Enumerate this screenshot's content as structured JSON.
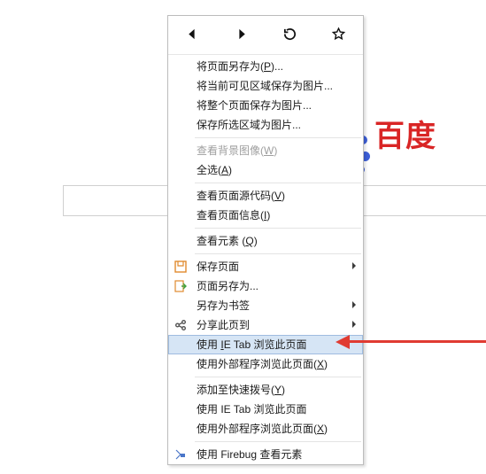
{
  "page": {
    "baidu_text": "百度"
  },
  "menu": {
    "save_page_as": "将页面另存为(",
    "save_page_as_key": "P",
    "save_page_as_tail": ")...",
    "save_visible_area_as_image": "将当前可见区域保存为图片...",
    "save_whole_page_as_image": "将整个页面保存为图片...",
    "save_selection_as_image": "保存所选区域为图片...",
    "view_bg_image": "查看背景图像(",
    "view_bg_image_key": "W",
    "view_bg_image_tail": ")",
    "select_all": "全选(",
    "select_all_key": "A",
    "select_all_tail": ")",
    "view_source": "查看页面源代码(",
    "view_source_key": "V",
    "view_source_tail": ")",
    "view_page_info": "查看页面信息(",
    "view_page_info_key": "I",
    "view_page_info_tail": ")",
    "inspect_element": "查看元素 (",
    "inspect_element_key": "Q",
    "inspect_element_tail": ")",
    "save_page": "保存页面",
    "page_save_as": "页面另存为...",
    "save_as_bookmark": "另存为书签",
    "share_page_to": "分享此页到",
    "use_ie_tab_prefix": "使用 ",
    "use_ie_tab_ie": "I",
    "use_ie_tab_mid": "E Tab 浏览此页面",
    "use_external_browse": "使用外部程序浏览此页面(",
    "use_external_browse_key": "X",
    "use_external_browse_tail": ")",
    "add_to_speed_dial": "添加至快速拨号(",
    "add_to_speed_dial_key": "Y",
    "add_to_speed_dial_tail": ")",
    "use_ie_tab2": "使用 IE Tab 浏览此页面",
    "use_external_browse2": "使用外部程序浏览此页面(",
    "use_external_browse2_key": "X",
    "use_external_browse2_tail": ")",
    "firebug_inspect": "使用 Firebug 查看元素"
  }
}
